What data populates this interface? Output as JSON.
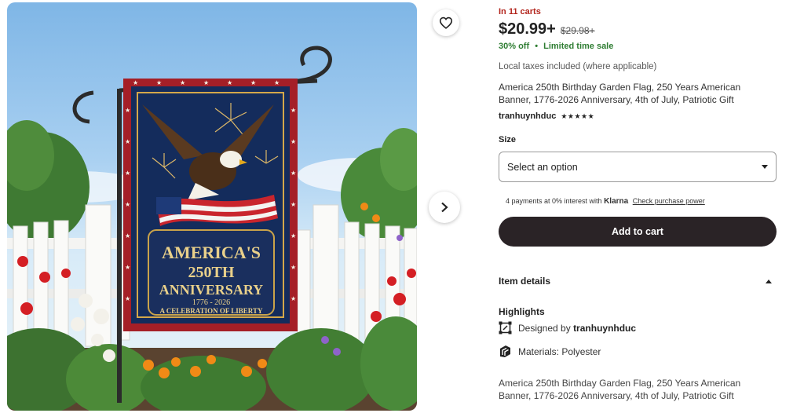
{
  "listing": {
    "in_carts": "In 11 carts",
    "price": "$20.99+",
    "original_price": "$29.98+",
    "discount": "30% off",
    "sale_label": "Limited time sale",
    "dot": "•",
    "taxes_note": "Local taxes included (where applicable)",
    "title": "America 250th Birthday Garden Flag, 250 Years American Banner, 1776-2026 Anniversary, 4th of July, Patriotic Gift",
    "seller": "tranhuynhduc",
    "rating_stars": "★★★★★"
  },
  "size": {
    "label": "Size",
    "selected": "Select an option"
  },
  "klarna": {
    "prefix": "4 payments at 0% interest with",
    "brand": "Klarna",
    "link": "Check purchase power"
  },
  "cart": {
    "add_label": "Add to cart"
  },
  "details": {
    "label": "Item details",
    "highlights_label": "Highlights",
    "designed_by_prefix": "Designed by",
    "designer": "tranhuynhduc",
    "materials": "Materials: Polyester",
    "description": "America 250th Birthday Garden Flag, 250 Years American Banner, 1776-2026 Anniversary, 4th of July, Patriotic Gift"
  },
  "flag": {
    "line1": "AMERICA'S",
    "line2": "250TH",
    "line3": "ANNIVERSARY",
    "line4": "1776 - 2026",
    "line5": "A CELEBRATION OF LIBERTY"
  },
  "icons": {
    "favorite": "heart-icon",
    "next": "chevron-right-icon",
    "designer": "design-tool-icon",
    "materials": "material-icon"
  },
  "colors": {
    "accent_red": "#b3261e",
    "sale_green": "#2e7d32",
    "cart_button": "#2a2326"
  }
}
